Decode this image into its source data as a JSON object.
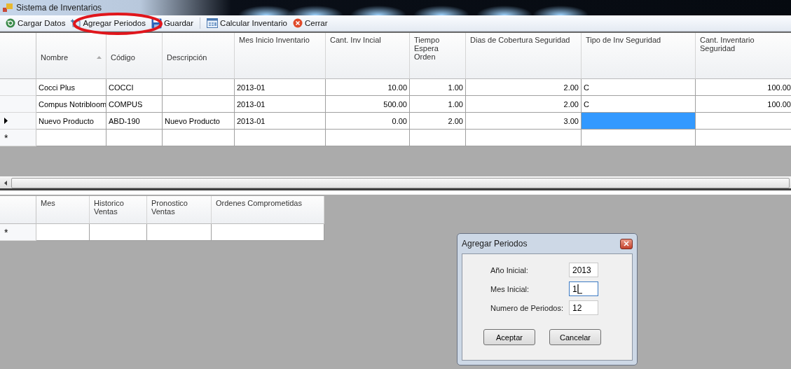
{
  "window": {
    "title": "Sistema de Inventarios"
  },
  "toolbar": [
    {
      "label": "Cargar Datos"
    },
    {
      "label": "Agregar Periodos"
    },
    {
      "label": "Guardar"
    },
    {
      "label": "Calcular Inventario"
    },
    {
      "label": "Cerrar"
    }
  ],
  "annotation": {
    "kind": "ellipse"
  },
  "products_grid": {
    "columns": [
      {
        "label": "Nombre",
        "kind": "text",
        "sorted": true
      },
      {
        "label": "Código",
        "kind": "text",
        "sorted": false
      },
      {
        "label": "Descripción",
        "kind": "text",
        "sorted": false
      },
      {
        "label": "Mes Inicio Inventario",
        "kind": "text",
        "sorted": false
      },
      {
        "label": "Cant. Inv Incial",
        "kind": "number",
        "sorted": false
      },
      {
        "label": "Tiempo Espera Orden",
        "kind": "number",
        "sorted": false
      },
      {
        "label": "Dias de Cobertura Seguridad",
        "kind": "number",
        "sorted": false
      },
      {
        "label": "Tipo de Inv Seguridad",
        "kind": "text",
        "sorted": false
      },
      {
        "label": "Cant. Inventario Seguridad",
        "kind": "number",
        "sorted": false
      }
    ],
    "rows": [
      {
        "current": false,
        "cells": [
          {
            "text": "Cocci Plus",
            "selected": false
          },
          {
            "text": "COCCI",
            "selected": false
          },
          {
            "selected": false
          },
          {
            "text": "2013-01",
            "selected": false
          },
          {
            "text": "10.00",
            "selected": false
          },
          {
            "text": "1.00",
            "selected": false
          },
          {
            "text": "2.00",
            "selected": false
          },
          {
            "text": "C",
            "selected": false
          },
          {
            "text": "100.00",
            "selected": false
          }
        ]
      },
      {
        "current": false,
        "cells": [
          {
            "text": "Compus Notribloom",
            "selected": false
          },
          {
            "text": "COMPUS",
            "selected": false
          },
          {
            "selected": false
          },
          {
            "text": "2013-01",
            "selected": false
          },
          {
            "text": "500.00",
            "selected": false
          },
          {
            "text": "1.00",
            "selected": false
          },
          {
            "text": "2.00",
            "selected": false
          },
          {
            "text": "C",
            "selected": false
          },
          {
            "text": "100.00",
            "selected": false
          }
        ]
      },
      {
        "current": true,
        "cells": [
          {
            "text": "Nuevo Producto",
            "selected": false
          },
          {
            "text": "ABD-190",
            "selected": false
          },
          {
            "text": "Nuevo Producto",
            "selected": false
          },
          {
            "text": "2013-01",
            "selected": false
          },
          {
            "text": "0.00",
            "selected": false
          },
          {
            "text": "2.00",
            "selected": false
          },
          {
            "text": "3.00",
            "selected": false
          },
          {
            "selected": true
          },
          {
            "selected": false
          }
        ]
      }
    ],
    "new_row_marker": "*"
  },
  "periods_grid": {
    "columns": [
      {
        "label": "Mes"
      },
      {
        "label": "Historico Ventas"
      },
      {
        "label": "Pronostico Ventas"
      },
      {
        "label": "Ordenes Comprometidas"
      }
    ],
    "new_row_marker": "*"
  },
  "dialog": {
    "title": "Agregar Periodos",
    "fields": [
      {
        "label": "Año Inicial:",
        "value": "2013",
        "focused": false
      },
      {
        "label": "Mes Inicial:",
        "value": "1",
        "focused": true
      },
      {
        "label": "Numero de Periodos:",
        "value": "12",
        "focused": false
      }
    ],
    "buttons": [
      "Aceptar",
      "Cancelar"
    ]
  }
}
